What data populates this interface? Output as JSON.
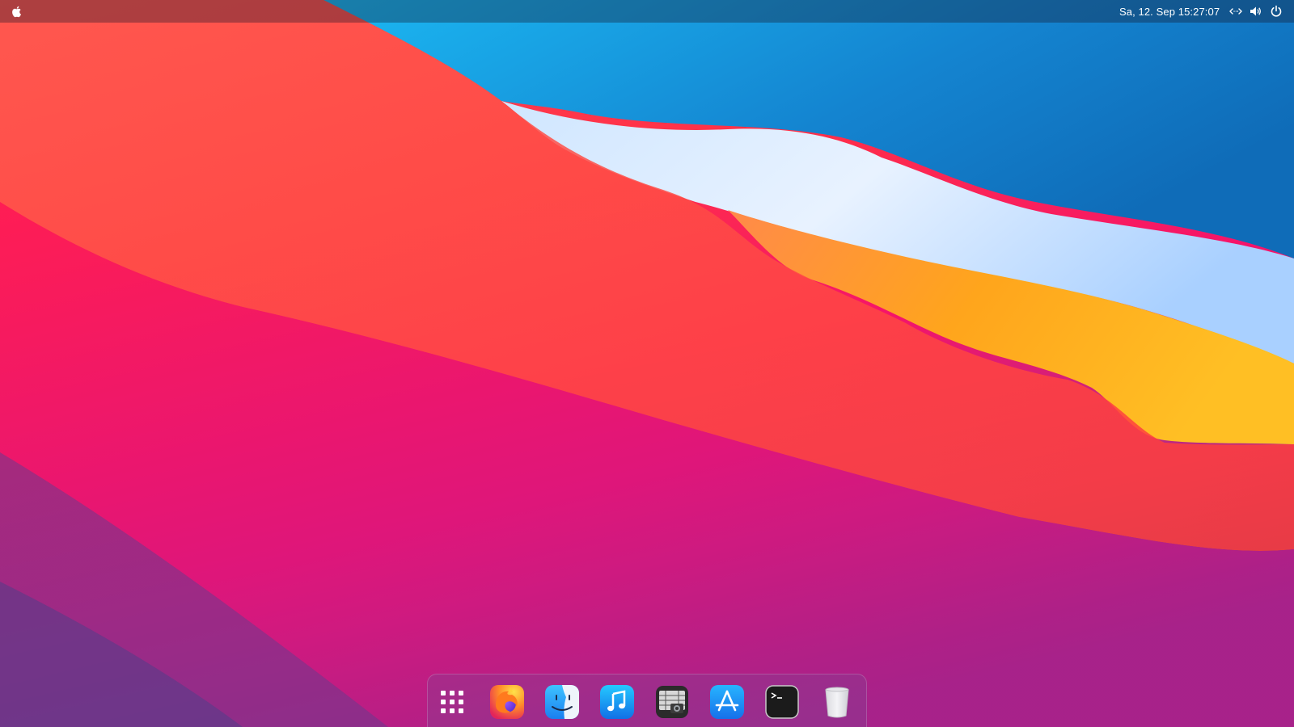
{
  "topbar": {
    "apple_menu_icon": "apple-logo-icon",
    "clock": "Sa, 12. Sep  15:27:07",
    "tray": [
      {
        "icon": "network-icon"
      },
      {
        "icon": "volume-icon"
      },
      {
        "icon": "power-icon"
      }
    ]
  },
  "dock": {
    "items": [
      {
        "name": "app-grid",
        "icon": "app-grid-icon"
      },
      {
        "name": "firefox",
        "icon": "firefox-icon"
      },
      {
        "name": "finder",
        "icon": "finder-icon"
      },
      {
        "name": "music",
        "icon": "music-icon"
      },
      {
        "name": "screenshot",
        "icon": "screenshot-icon"
      },
      {
        "name": "app-store",
        "icon": "app-store-icon"
      },
      {
        "name": "terminal",
        "icon": "terminal-icon"
      },
      {
        "name": "trash",
        "icon": "trash-icon"
      }
    ]
  },
  "colors": {
    "wallpaper_red": "#ff2a44",
    "wallpaper_blue": "#1190d8",
    "wallpaper_orange": "#ffa41a",
    "wallpaper_purple": "#6b3d8c"
  }
}
